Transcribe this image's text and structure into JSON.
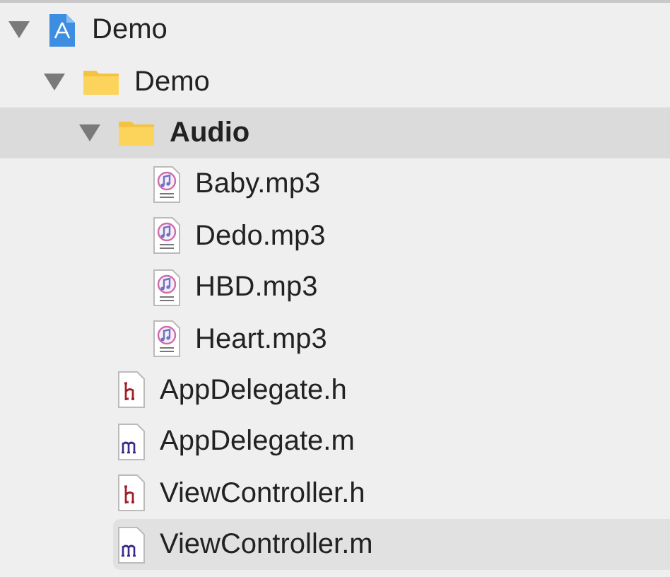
{
  "navigator": {
    "items": [
      {
        "kind": "project",
        "label": "Demo",
        "expanded": true,
        "selected": false,
        "highlighted": false,
        "children": [
          {
            "kind": "folder",
            "label": "Demo",
            "expanded": true,
            "selected": false,
            "highlighted": false,
            "children": [
              {
                "kind": "folder",
                "label": "Audio",
                "expanded": true,
                "selected": true,
                "highlighted": false,
                "children": [
                  {
                    "kind": "mp3",
                    "label": "Baby.mp3",
                    "selected": false,
                    "highlighted": false
                  },
                  {
                    "kind": "mp3",
                    "label": "Dedo.mp3",
                    "selected": false,
                    "highlighted": false
                  },
                  {
                    "kind": "mp3",
                    "label": "HBD.mp3",
                    "selected": false,
                    "highlighted": false
                  },
                  {
                    "kind": "mp3",
                    "label": "Heart.mp3",
                    "selected": false,
                    "highlighted": false
                  }
                ]
              },
              {
                "kind": "header",
                "label": "AppDelegate.h",
                "selected": false,
                "highlighted": false
              },
              {
                "kind": "source",
                "label": "AppDelegate.m",
                "selected": false,
                "highlighted": false
              },
              {
                "kind": "header",
                "label": "ViewController.h",
                "selected": false,
                "highlighted": false
              },
              {
                "kind": "source",
                "label": "ViewController.m",
                "selected": false,
                "highlighted": true
              }
            ]
          }
        ]
      }
    ]
  }
}
